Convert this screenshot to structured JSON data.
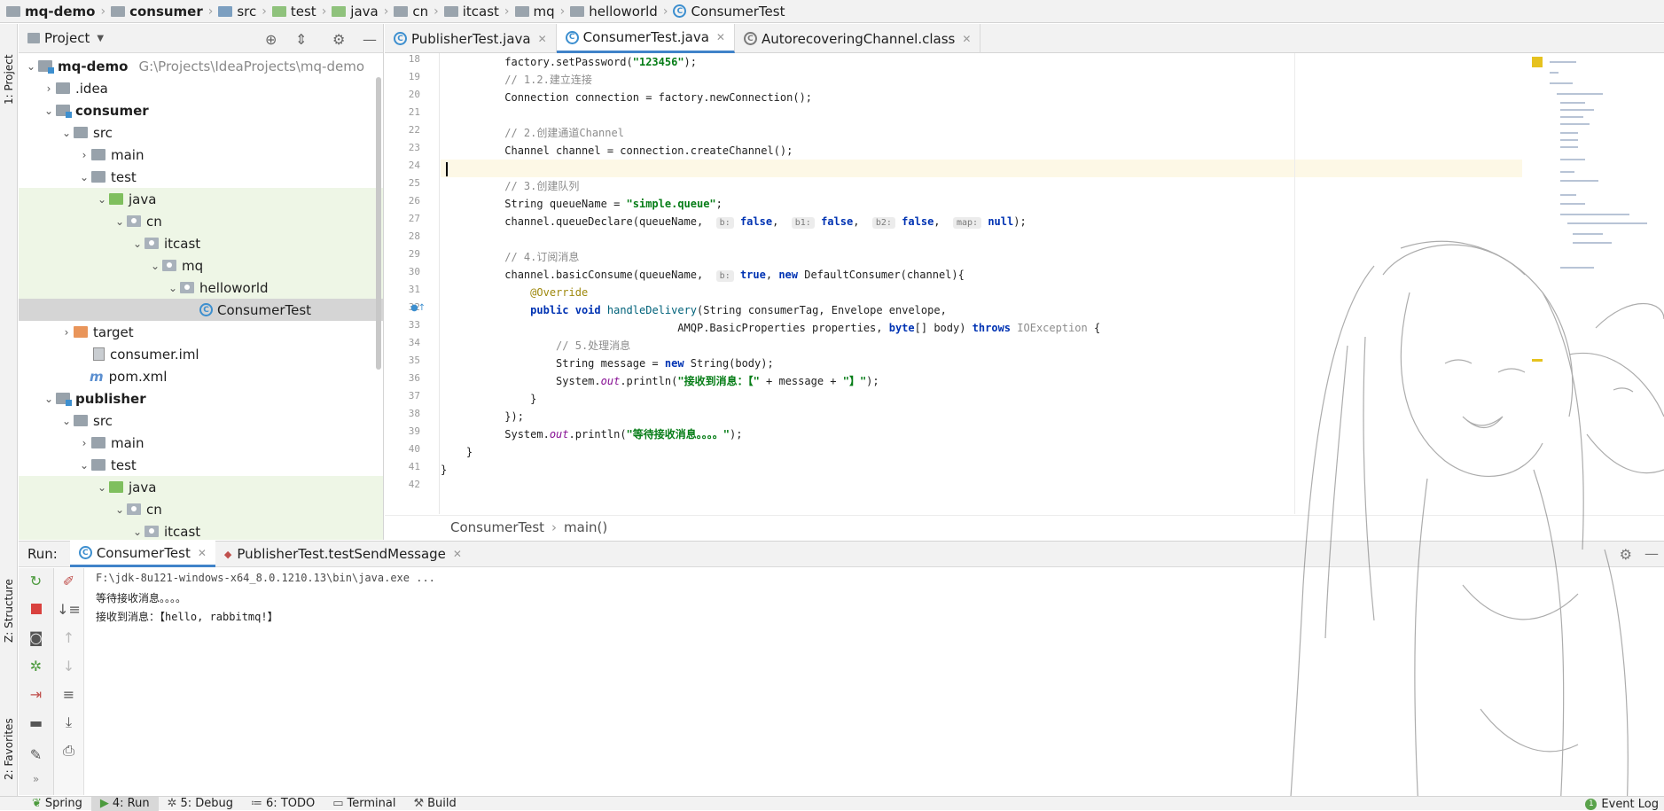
{
  "breadcrumb": [
    {
      "label": "mq-demo",
      "icon": "module-icon"
    },
    {
      "label": "consumer",
      "icon": "folder-icon"
    },
    {
      "label": "src",
      "icon": "folder-icon"
    },
    {
      "label": "test",
      "icon": "folder-icon"
    },
    {
      "label": "java",
      "icon": "folder-icon"
    },
    {
      "label": "cn",
      "icon": "folder-icon"
    },
    {
      "label": "itcast",
      "icon": "folder-icon"
    },
    {
      "label": "mq",
      "icon": "folder-icon"
    },
    {
      "label": "helloworld",
      "icon": "folder-icon"
    },
    {
      "label": "ConsumerTest",
      "icon": "class-icon"
    }
  ],
  "tool_strip": {
    "project": "1: Project",
    "structure": "Z: Structure",
    "favorites": "2: Favorites"
  },
  "project": {
    "title": "Project",
    "tree": [
      {
        "label": "mq-demo",
        "extra": "G:\\Projects\\IdeaProjects\\mq-demo",
        "bold": true
      },
      {
        "label": ".idea"
      },
      {
        "label": "consumer",
        "bold": true
      },
      {
        "label": "src"
      },
      {
        "label": "main"
      },
      {
        "label": "test"
      },
      {
        "label": "java"
      },
      {
        "label": "cn"
      },
      {
        "label": "itcast"
      },
      {
        "label": "mq"
      },
      {
        "label": "helloworld"
      },
      {
        "label": "ConsumerTest"
      },
      {
        "label": "target"
      },
      {
        "label": "consumer.iml"
      },
      {
        "label": "pom.xml"
      },
      {
        "label": "publisher",
        "bold": true
      },
      {
        "label": "src"
      },
      {
        "label": "main"
      },
      {
        "label": "test"
      },
      {
        "label": "java"
      },
      {
        "label": "cn"
      },
      {
        "label": "itcast"
      }
    ]
  },
  "editor": {
    "tabs": [
      {
        "label": "PublisherTest.java"
      },
      {
        "label": "ConsumerTest.java"
      },
      {
        "label": "AutorecoveringChannel.class"
      }
    ],
    "line_numbers": [
      "18",
      "19",
      "20",
      "21",
      "22",
      "23",
      "24",
      "25",
      "26",
      "27",
      "28",
      "29",
      "30",
      "31",
      "32",
      "33",
      "34",
      "35",
      "36",
      "37",
      "38",
      "39",
      "40",
      "41",
      "42"
    ],
    "code_breadcrumb": {
      "class": "ConsumerTest",
      "method": "main()"
    }
  },
  "run": {
    "label": "Run:",
    "tabs": [
      {
        "label": "ConsumerTest"
      },
      {
        "label": "PublisherTest.testSendMessage"
      }
    ],
    "output": [
      "F:\\jdk-8u121-windows-x64_8.0.1210.13\\bin\\java.exe ...",
      "等待接收消息。。。。",
      "接收到消息：【hello, rabbitmq!】"
    ]
  },
  "statusbar": {
    "items": [
      {
        "label": "Spring"
      },
      {
        "label": "4: Run"
      },
      {
        "label": "5: Debug"
      },
      {
        "label": "6: TODO"
      },
      {
        "label": "Terminal"
      },
      {
        "label": "Build"
      }
    ],
    "event_log": "Event Log",
    "event_count": "1"
  },
  "colors": {
    "accent": "#4083c9",
    "keyword": "#0033b3",
    "string": "#067d17",
    "comment": "#8c8c8c",
    "annotation": "#9e880d"
  }
}
